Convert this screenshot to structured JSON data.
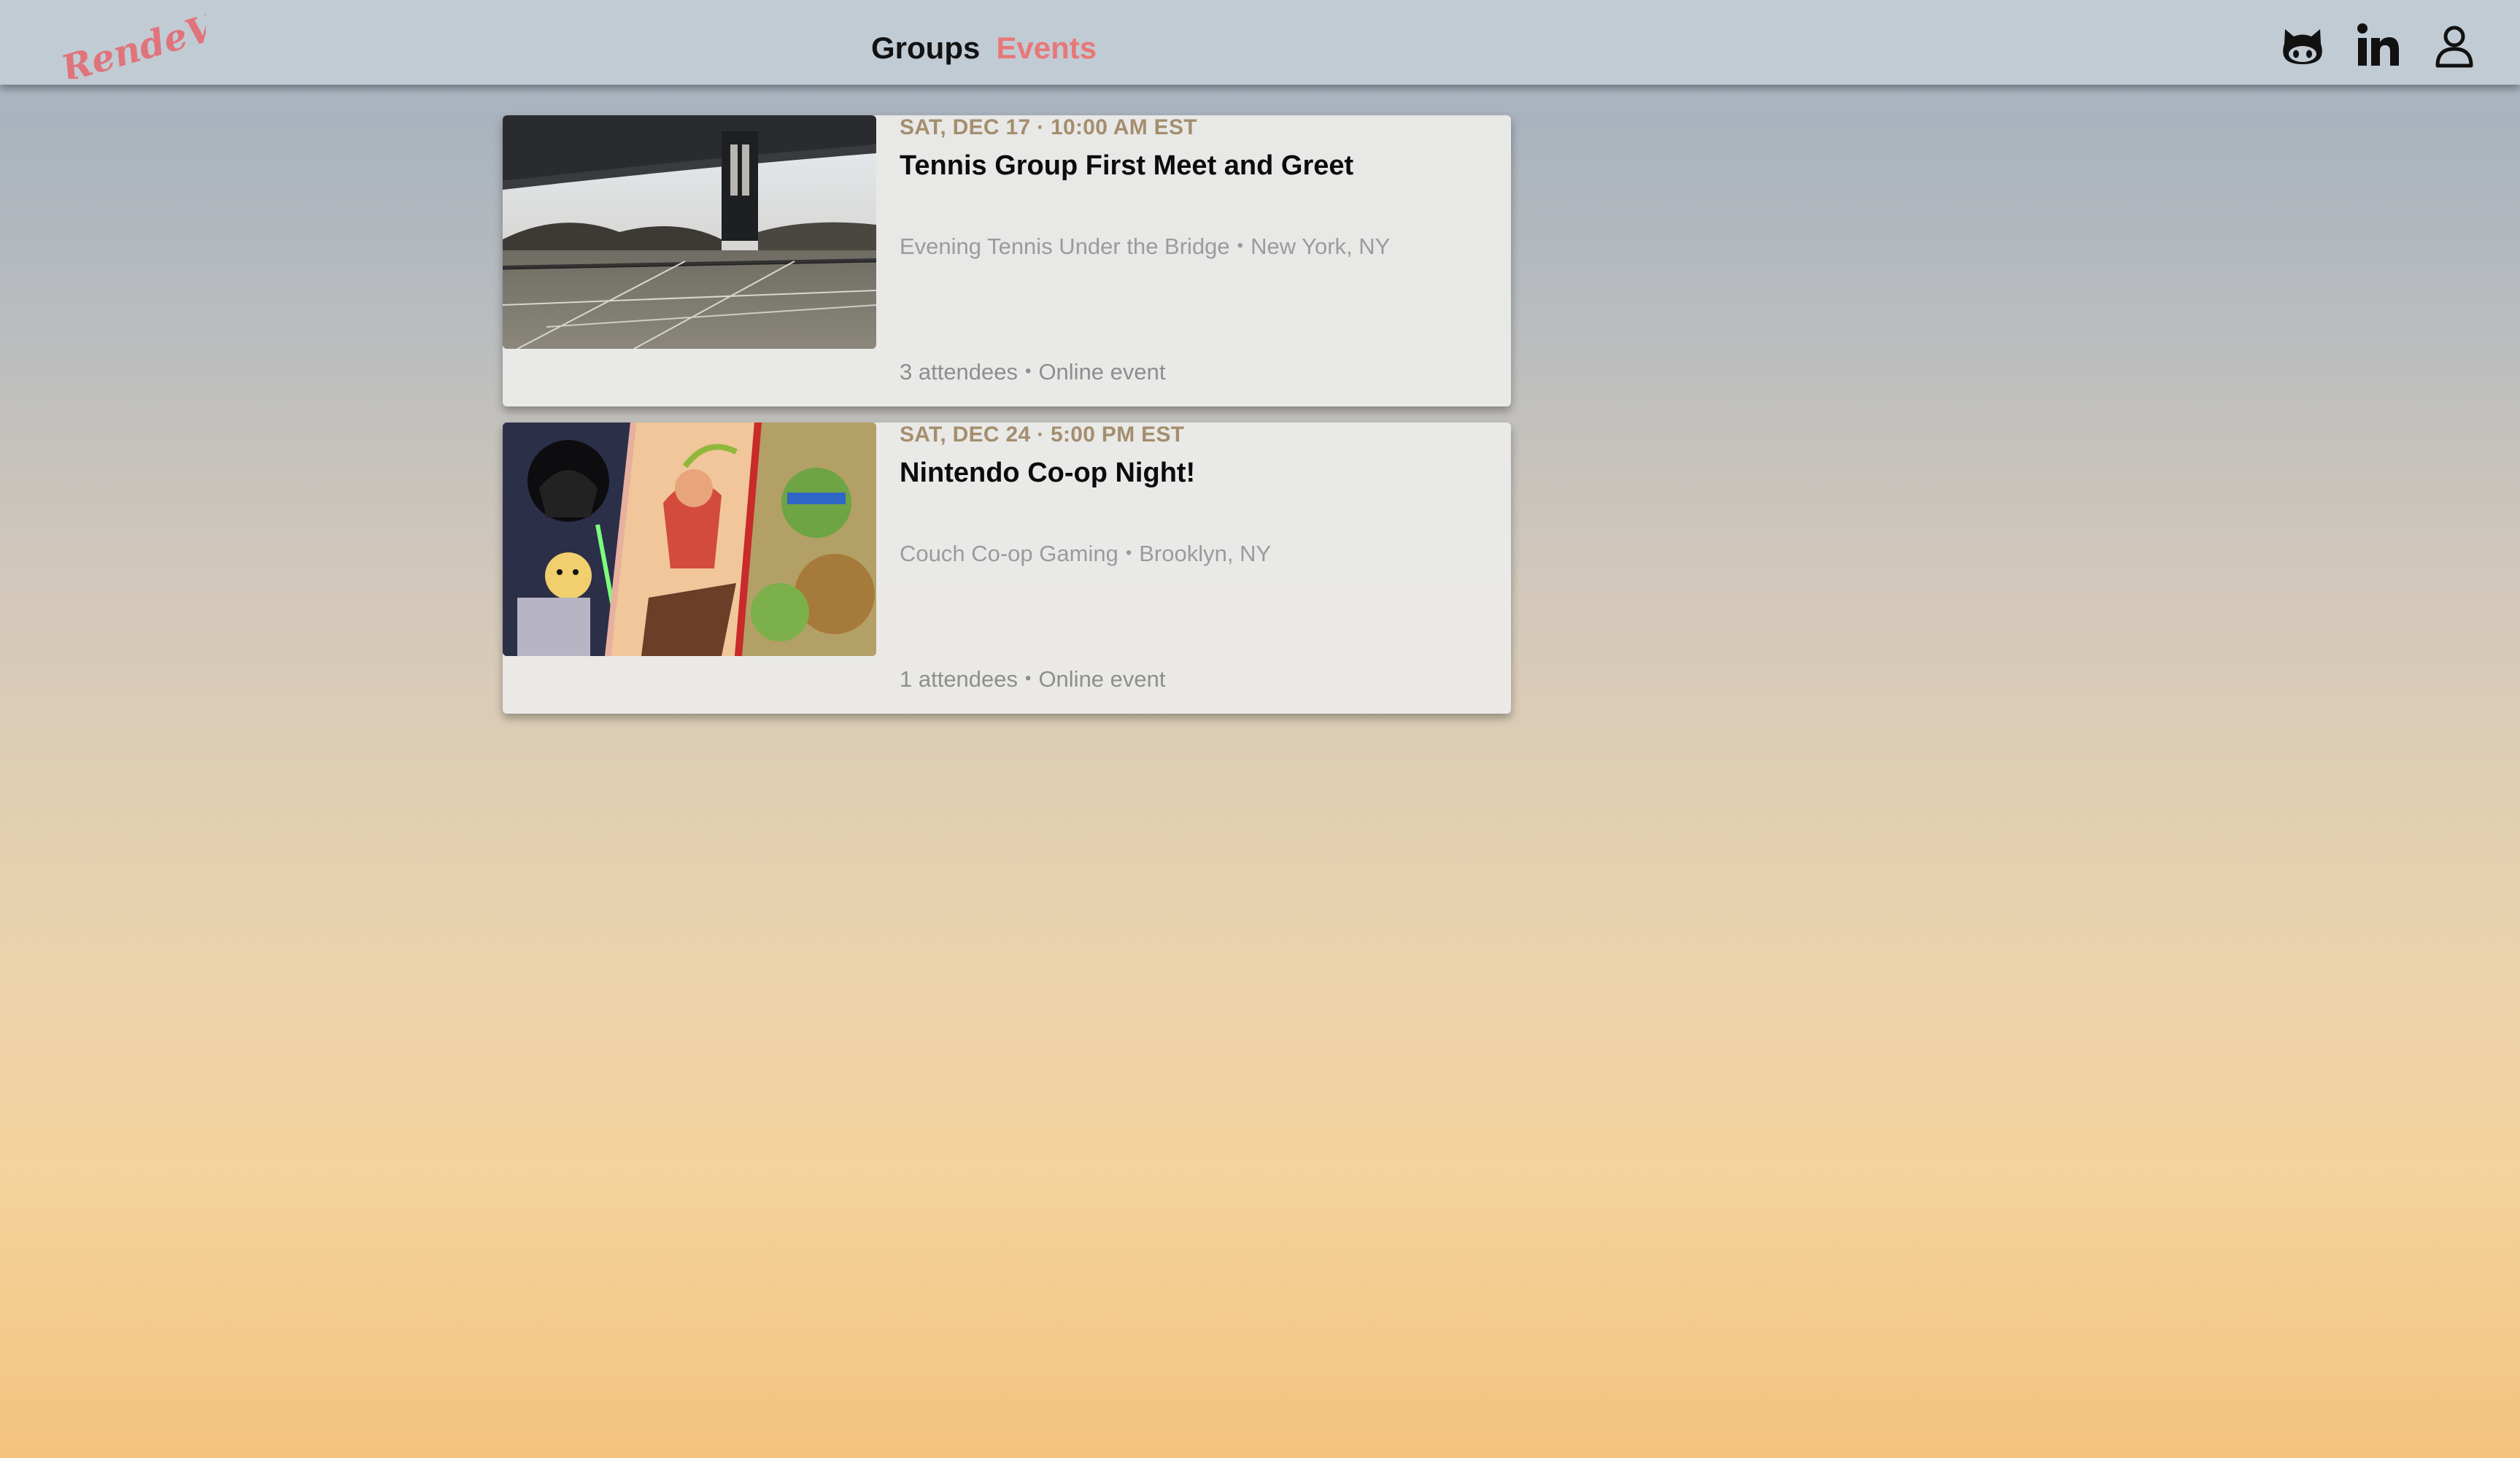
{
  "app": {
    "logo_text": "RendeVue"
  },
  "nav": {
    "links": [
      {
        "label": "Groups",
        "active": false
      },
      {
        "label": "Events",
        "active": true
      }
    ],
    "icons": [
      "github-icon",
      "linkedin-icon",
      "user-icon"
    ]
  },
  "colors": {
    "accent": "#e87878",
    "date": "#a48e6d",
    "muted": "#9b9b9b"
  },
  "events": [
    {
      "date": "SAT, DEC 17 · 10:00 AM EST",
      "title": "Tennis Group First Meet and Greet",
      "group": "Evening Tennis Under the Bridge",
      "location": "New York, NY",
      "attendees": "3 attendees",
      "type": "Online event",
      "image": "tennis-court-bridge-photo"
    },
    {
      "date": "SAT, DEC 24 · 5:00 PM EST",
      "title": "Nintendo Co-op Night!",
      "group": "Couch Co-op Gaming",
      "location": "Brooklyn, NY",
      "attendees": "1 attendees",
      "type": "Online event",
      "image": "video-game-collage-photo"
    }
  ]
}
